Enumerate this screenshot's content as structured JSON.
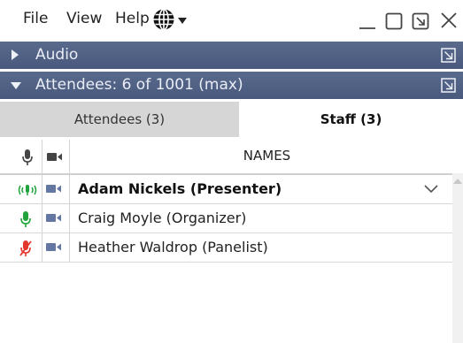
{
  "menu": {
    "file": "File",
    "view": "View",
    "help": "Help"
  },
  "icons": {
    "language": "globe-icon",
    "minimize": "minimize-icon",
    "restore": "restore-icon",
    "popout": "popout-icon",
    "close": "close-icon"
  },
  "sections": {
    "audio": {
      "title": "Audio"
    },
    "attendees": {
      "title": "Attendees: 6 of 1001 (max)"
    }
  },
  "tabs": {
    "attendees": "Attendees (3)",
    "staff": "Staff (3)"
  },
  "table": {
    "header_names": "NAMES",
    "rows": [
      {
        "name": "Adam Nickels (Presenter)",
        "mic": "speaking",
        "bold": true
      },
      {
        "name": "Craig Moyle (Organizer)",
        "mic": "on",
        "bold": false
      },
      {
        "name": "Heather Waldrop (Panelist)",
        "mic": "muted",
        "bold": false
      }
    ]
  },
  "colors": {
    "section_bg": "#4f5f83",
    "mic_green": "#1fa33a",
    "mic_red": "#e2372f",
    "cam_blue": "#6477a3"
  }
}
